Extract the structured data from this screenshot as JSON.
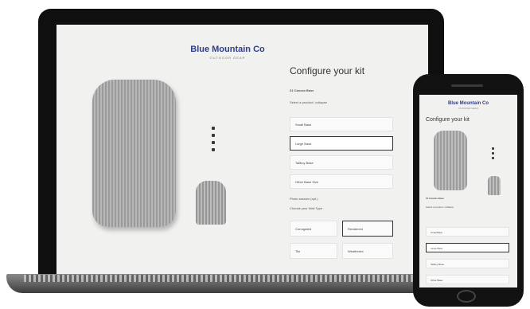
{
  "brand": {
    "name": "Blue Mountain Co",
    "tagline": "OUTDOOR GEAR"
  },
  "configurator": {
    "title": "Configure your kit",
    "step": "01  Canvas Base",
    "prompt": "Select a product / collapse",
    "options": [
      "Small Base",
      "Large Base",
      "Tallboy Base",
      "Other Base Size"
    ],
    "selected_index": 1,
    "section_label": "Photo session (opt.)",
    "sub_prompt": "Choose your Wall Type",
    "wall_options": [
      "Corrugated",
      "Reclaimed",
      "Tile",
      "Weathered"
    ],
    "wall_selected_index": 1
  },
  "mobile": {
    "brand": "Blue Mountain Co",
    "tagline": "OUTDOOR GEAR",
    "title": "Configure your kit",
    "step": "01  Canvas Base",
    "prompt": "Select a product / collapse",
    "options": [
      "Small Base",
      "Large Base",
      "Tallboy Base",
      "Other Base"
    ],
    "selected_index": 1
  },
  "colors": {
    "brand": "#2f3e8c",
    "device": "#121213",
    "screen": "#f1f1f0"
  }
}
